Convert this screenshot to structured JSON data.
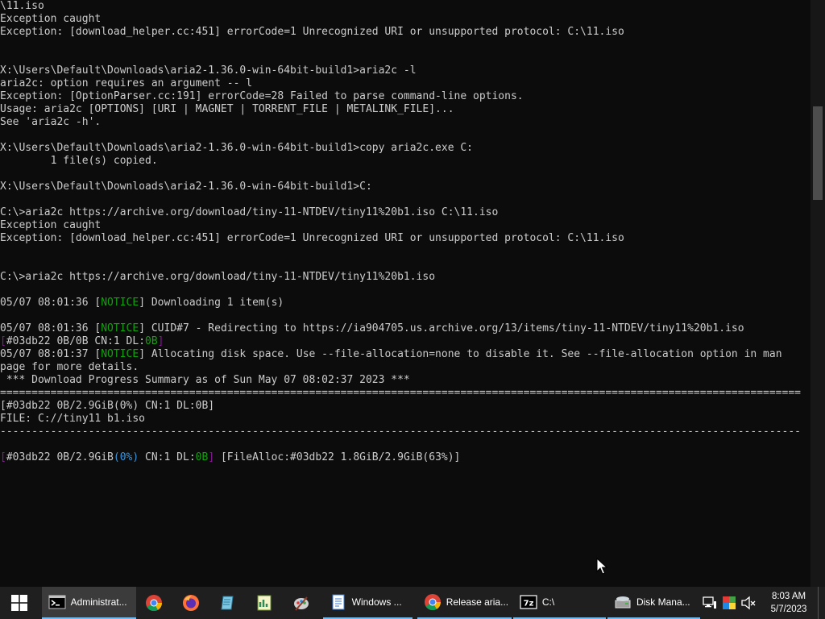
{
  "console": {
    "lines": [
      [
        {
          "t": "\\11.iso"
        }
      ],
      [
        {
          "t": "Exception caught"
        }
      ],
      [
        {
          "t": "Exception: [download_helper.cc:451] errorCode=1 Unrecognized URI or unsupported protocol: C:\\11.iso"
        }
      ],
      [
        {
          "t": ""
        }
      ],
      [
        {
          "t": ""
        }
      ],
      [
        {
          "t": "X:\\Users\\Default\\Downloads\\aria2-1.36.0-win-64bit-build1>aria2c -l"
        }
      ],
      [
        {
          "t": "aria2c: option requires an argument -- l"
        }
      ],
      [
        {
          "t": "Exception: [OptionParser.cc:191] errorCode=28 Failed to parse command-line options."
        }
      ],
      [
        {
          "t": "Usage: aria2c [OPTIONS] [URI | MAGNET | TORRENT_FILE | METALINK_FILE]..."
        }
      ],
      [
        {
          "t": "See 'aria2c -h'."
        }
      ],
      [
        {
          "t": ""
        }
      ],
      [
        {
          "t": "X:\\Users\\Default\\Downloads\\aria2-1.36.0-win-64bit-build1>copy aria2c.exe C:"
        }
      ],
      [
        {
          "t": "        1 file(s) copied."
        }
      ],
      [
        {
          "t": ""
        }
      ],
      [
        {
          "t": "X:\\Users\\Default\\Downloads\\aria2-1.36.0-win-64bit-build1>C:"
        }
      ],
      [
        {
          "t": ""
        }
      ],
      [
        {
          "t": "C:\\>aria2c https://archive.org/download/tiny-11-NTDEV/tiny11%20b1.iso C:\\11.iso"
        }
      ],
      [
        {
          "t": "Exception caught"
        }
      ],
      [
        {
          "t": "Exception: [download_helper.cc:451] errorCode=1 Unrecognized URI or unsupported protocol: C:\\11.iso"
        }
      ],
      [
        {
          "t": ""
        }
      ],
      [
        {
          "t": ""
        }
      ],
      [
        {
          "t": "C:\\>aria2c https://archive.org/download/tiny-11-NTDEV/tiny11%20b1.iso"
        }
      ],
      [
        {
          "t": ""
        }
      ],
      [
        {
          "t": "05/07 08:01:36 ["
        },
        {
          "t": "NOTICE",
          "c": "notice"
        },
        {
          "t": "] Downloading 1 item(s)"
        }
      ],
      [
        {
          "t": ""
        }
      ],
      [
        {
          "t": "05/07 08:01:36 ["
        },
        {
          "t": "NOTICE",
          "c": "notice"
        },
        {
          "t": "] CUID#7 - Redirecting to https://ia904705.us.archive.org/13/items/tiny-11-NTDEV/tiny11%20b1.iso"
        }
      ],
      [
        {
          "t": "[",
          "c": "purple"
        },
        {
          "t": "#03db22 0B/0B CN:1 DL:"
        },
        {
          "t": "0B",
          "c": "green"
        },
        {
          "t": "]",
          "c": "purple"
        }
      ],
      [
        {
          "t": "05/07 08:01:37 ["
        },
        {
          "t": "NOTICE",
          "c": "notice"
        },
        {
          "t": "] Allocating disk space. Use --file-allocation=none to disable it. See --file-allocation option in man"
        }
      ],
      [
        {
          "t": "page for more details."
        }
      ],
      [
        {
          "t": " *** Download Progress Summary as of Sun May 07 08:02:37 2023 ***"
        }
      ],
      [
        {
          "t": "==============================================================================================================================="
        }
      ],
      [
        {
          "t": "[#03db22 0B/2.9GiB(0%) CN:1 DL:0B]"
        }
      ],
      [
        {
          "t": "FILE: C://tiny11 b1.iso"
        }
      ],
      [
        {
          "t": "-------------------------------------------------------------------------------------------------------------------------------"
        }
      ],
      [
        {
          "t": ""
        }
      ],
      [
        {
          "t": "[",
          "c": "purple"
        },
        {
          "t": "#03db22 0B/2.9GiB"
        },
        {
          "t": "(0%)",
          "c": "blue"
        },
        {
          "t": " CN:1 DL:"
        },
        {
          "t": "0B",
          "c": "green"
        },
        {
          "t": "]",
          "c": "purple"
        },
        {
          "t": " [FileAlloc:#03db22 1.8GiB/2.9GiB(63%)]"
        }
      ]
    ]
  },
  "taskbar": {
    "tasks": [
      {
        "label": "Administrat...",
        "icon": "cmd-icon"
      },
      {
        "label": "Windows ...",
        "icon": "notepad-icon"
      },
      {
        "label": "Release aria...",
        "icon": "chrome-icon"
      },
      {
        "label": "C:\\",
        "icon": "7zip-icon",
        "icon_text": "7z"
      },
      {
        "label": "Disk Mana...",
        "icon": "disk-management-icon"
      }
    ],
    "pinned": [
      "chrome-icon",
      "firefox-icon",
      "notepad-icon",
      "spreadsheet-icon",
      "paint-icon"
    ]
  },
  "tray": {
    "time": "8:03 AM",
    "date": "5/7/2023",
    "icons": [
      "network-icon",
      "color-icon",
      "volume-muted-icon"
    ]
  },
  "colors": {
    "console_bg": "#0c0c0c",
    "console_fg": "#cccccc",
    "notice": "#13a10e",
    "purple": "#881798",
    "blue": "#3a96dd",
    "taskbar_bg": "#1f1f1f",
    "accent": "#76b9ed"
  }
}
